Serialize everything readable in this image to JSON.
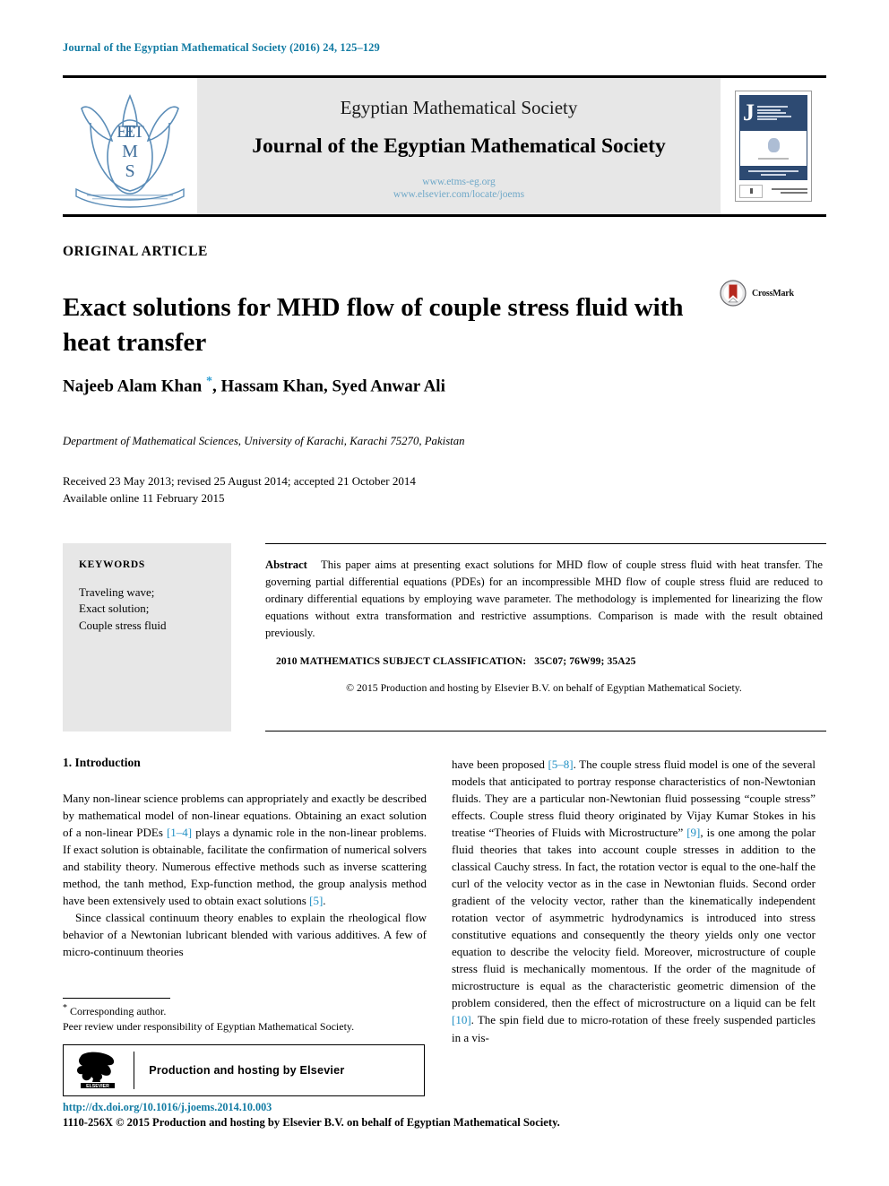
{
  "running_head": "Journal of the Egyptian Mathematical Society (2016) 24, 125–129",
  "masthead": {
    "society": "Egyptian Mathematical Society",
    "journal": "Journal of the Egyptian Mathematical Society",
    "url_society": "www.etms-eg.org",
    "url_elsevier": "www.elsevier.com/locate/joems",
    "logo_text": "ETMS",
    "logo_letters": [
      "E",
      "T",
      "M",
      "S"
    ],
    "cover_initial": "J",
    "colors": {
      "link_blue": "#6FA8C8",
      "banner_grey": "#e7e7e7",
      "cover_navy": "#2d4a72",
      "logo_blue": "#5B8DB8"
    }
  },
  "article": {
    "type_label": "ORIGINAL ARTICLE",
    "title": "Exact solutions for MHD flow of couple stress fluid with heat transfer",
    "crossmark_label": "CrossMark",
    "authors": "Najeeb Alam Khan ",
    "authors_rest": ", Hassam Khan, Syed Anwar Ali",
    "corresponding_marker": "*",
    "affiliation": "Department of Mathematical Sciences, University of Karachi, Karachi 75270, Pakistan",
    "history_line1": "Received 23 May 2013; revised 25 August 2014; accepted 21 October 2014",
    "history_line2": "Available online 11 February 2015"
  },
  "keywords": {
    "heading": "KEYWORDS",
    "items": [
      "Traveling wave;",
      "Exact solution;",
      "Couple stress fluid"
    ]
  },
  "abstract": {
    "label": "Abstract",
    "text": "This paper aims at presenting exact solutions for MHD flow of couple stress fluid with heat transfer. The governing partial differential equations (PDEs) for an incompressible MHD flow of couple stress fluid are reduced to ordinary differential equations by employing wave parameter. The methodology is implemented for linearizing the flow equations without extra transformation and restrictive assumptions. Comparison is made with the result obtained previously.",
    "msc_label": "2010 MATHEMATICS SUBJECT CLASSIFICATION:",
    "msc_codes": "35C07; 76W99; 35A25",
    "copyright": "© 2015 Production and hosting by Elsevier B.V. on behalf of Egyptian Mathematical Society."
  },
  "body": {
    "section_heading": "1. Introduction",
    "left_paragraph_1_a": "Many non-linear science problems can appropriately and exactly be described by mathematical model of non-linear equations. Obtaining an exact solution of a non-linear PDEs ",
    "left_ref_1": "[1–4]",
    "left_paragraph_1_b": " plays a dynamic role in the non-linear problems. If exact solution is obtainable, facilitate the confirmation of numerical solvers and stability theory. Numerous effective methods such as inverse scattering method, the tanh method, Exp-function method, the group analysis method have been extensively used to obtain exact solutions ",
    "left_ref_2": "[5]",
    "left_paragraph_1_c": ".",
    "left_paragraph_2": "Since classical continuum theory enables to explain the rheological flow behavior of a Newtonian lubricant blended with various additives. A few of micro-continuum theories",
    "right_paragraph_a": "have been proposed ",
    "right_ref_1": "[5–8]",
    "right_paragraph_b": ". The couple stress fluid model is one of the several models that anticipated to portray response characteristics of non-Newtonian fluids. They are a particular non-Newtonian fluid possessing “couple stress” effects. Couple stress fluid theory originated by Vijay Kumar Stokes in his treatise “Theories of Fluids with Microstructure” ",
    "right_ref_2": "[9]",
    "right_paragraph_c": ", is one among the polar fluid theories that takes into account couple stresses in addition to the classical Cauchy stress. In fact, the rotation vector is equal to the one-half the curl of the velocity vector as in the case in Newtonian fluids. Second order gradient of the velocity vector, rather than the kinematically independent rotation vector of asymmetric hydrodynamics is introduced into stress constitutive equations and consequently the theory yields only one vector equation to describe the velocity field. Moreover, microstructure of couple stress fluid is mechanically momentous. If the order of the magnitude of microstructure is equal as the characteristic geometric dimension of the problem considered, then the effect of microstructure on a liquid can be felt ",
    "right_ref_3": "[10]",
    "right_paragraph_d": ". The spin field due to micro-rotation of these freely suspended particles in a vis-"
  },
  "footnotes": {
    "corresponding": "Corresponding author.",
    "corresponding_marker": "*",
    "peer_review": "Peer review under responsibility of Egyptian Mathematical Society.",
    "elsevier_banner": "Production and hosting by Elsevier",
    "elsevier_wordmark": "ELSEVIER"
  },
  "footer": {
    "doi": "http://dx.doi.org/10.1016/j.joems.2014.10.003",
    "issn_line": "1110-256X © 2015 Production and hosting by Elsevier B.V. on behalf of Egyptian Mathematical Society."
  }
}
